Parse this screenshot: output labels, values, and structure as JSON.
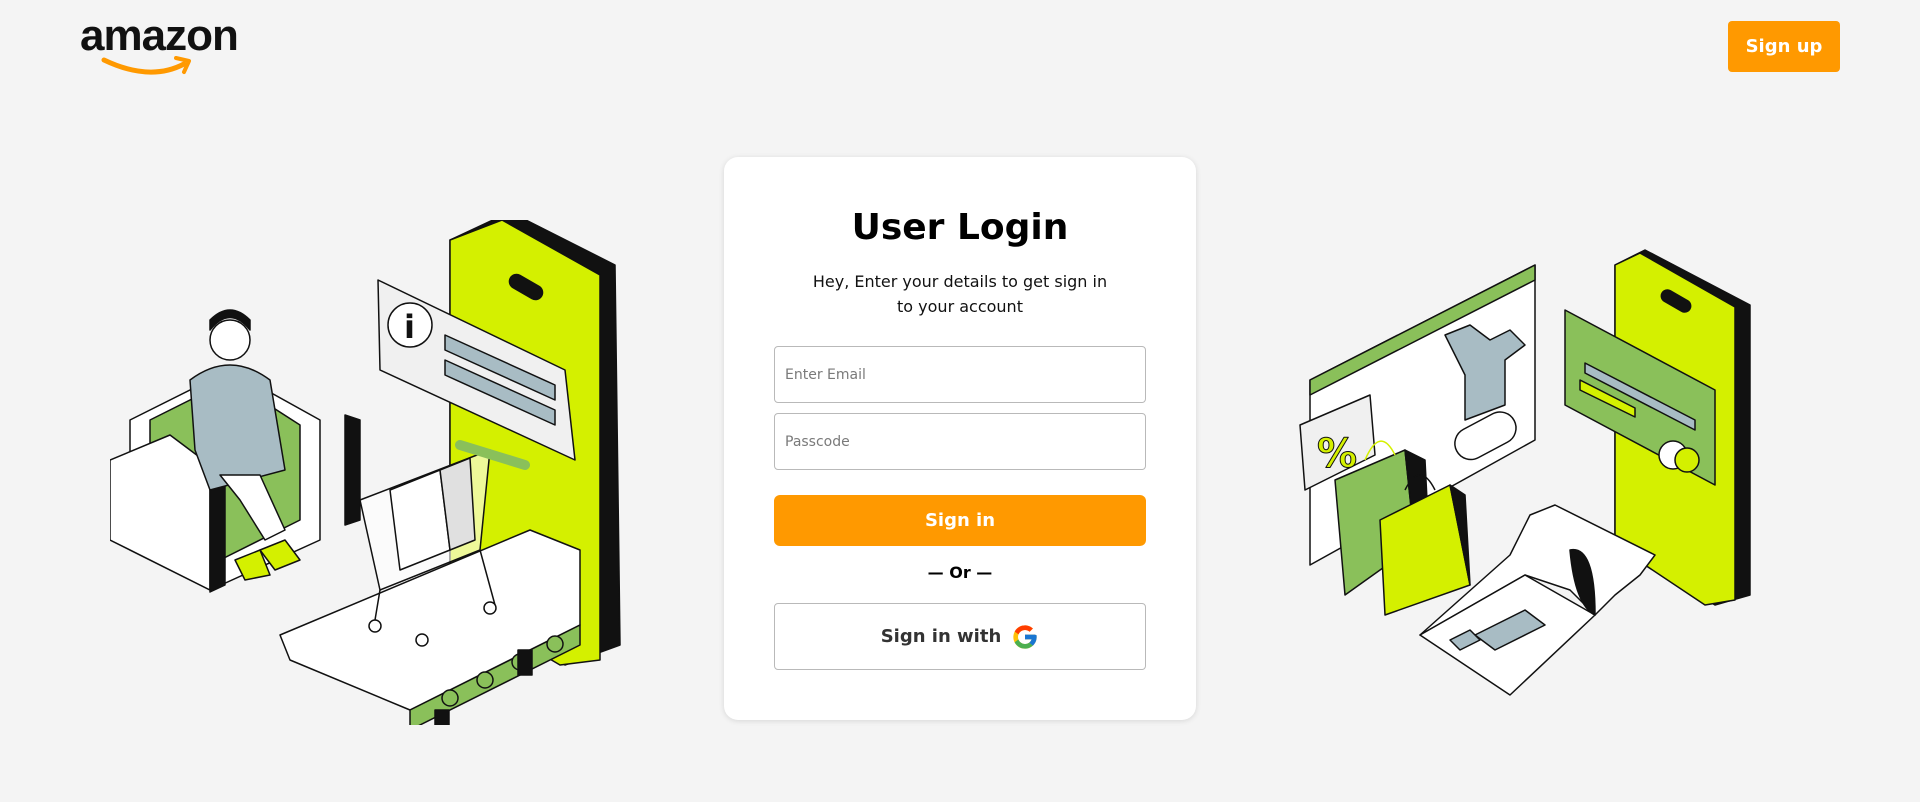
{
  "header": {
    "logo_text": "amazon",
    "signup_label": "Sign up"
  },
  "login": {
    "title": "User Login",
    "subtitle": "Hey, Enter your details to get sign in to your account",
    "email_placeholder": "Enter Email",
    "passcode_placeholder": "Passcode",
    "signin_label": "Sign in",
    "or_label": "— Or —",
    "google_label": "Sign in with"
  },
  "icons": {
    "google": "google-icon",
    "logo_arrow": "amazon-smile-arrow"
  },
  "colors": {
    "accent": "#ff9900",
    "background": "#f4f4f4",
    "illustration_lime": "#d4f000",
    "illustration_green": "#8ac05a"
  }
}
